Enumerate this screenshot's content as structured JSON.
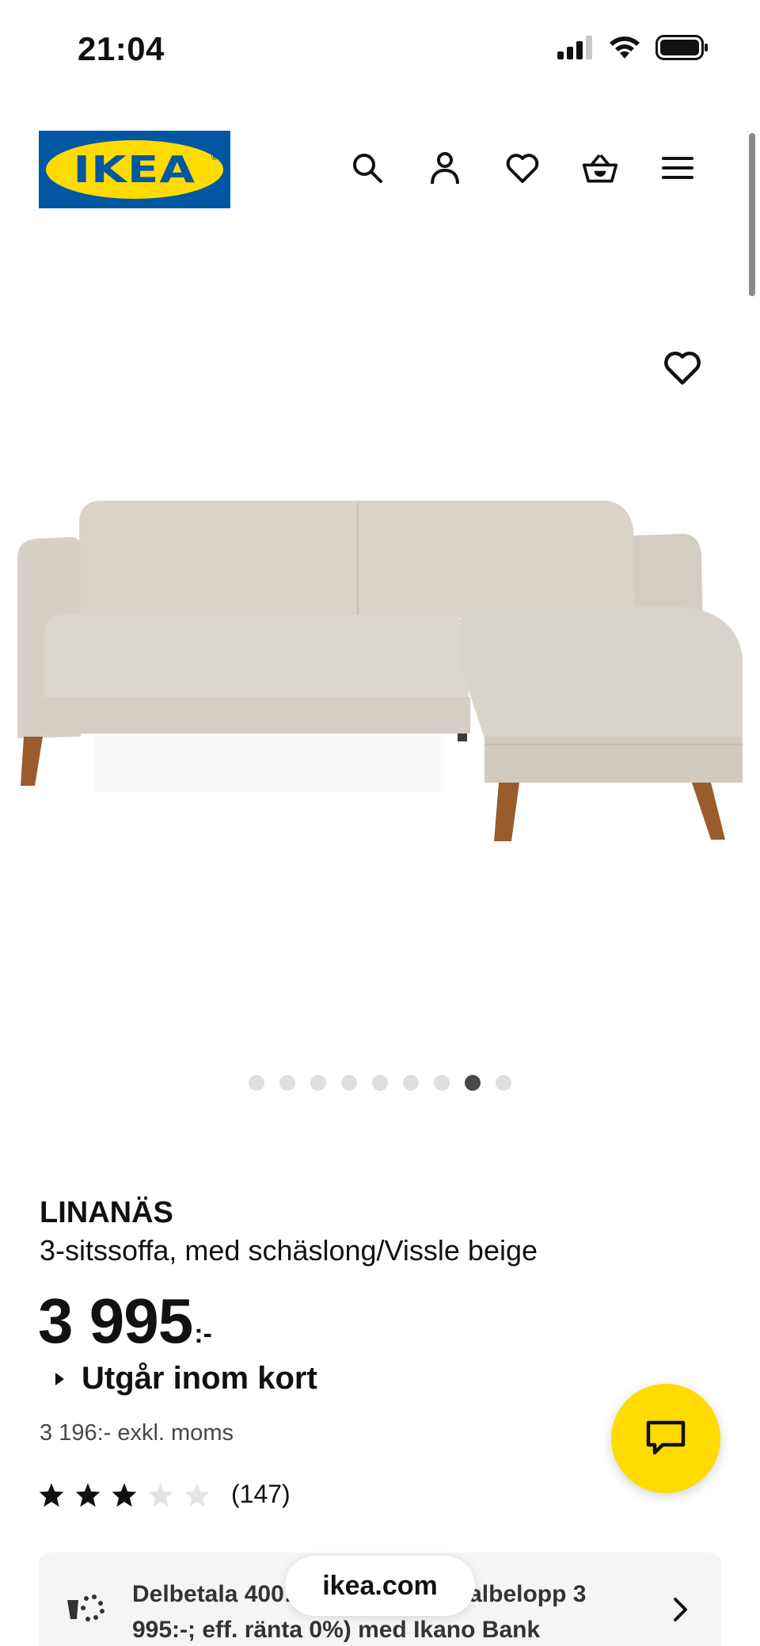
{
  "status_bar": {
    "time": "21:04"
  },
  "header": {
    "logo_text": "IKEA"
  },
  "product": {
    "name": "LINANÄS",
    "description": "3-sitssoffa, med schäslong/Vissle beige",
    "price": "3 995",
    "price_suffix": ":-",
    "availability": "Utgår inom kort",
    "price_excl_vat": "3 196:- exkl. moms",
    "rating": {
      "value": 3,
      "max": 5,
      "count": "(147)"
    },
    "image_count": 9,
    "active_image_index": 7
  },
  "financing": {
    "text": "Delbetala 400:- i månaden (totalbelopp 3 995:-; eff. ränta 0%) med Ikano Bank"
  },
  "browser": {
    "url": "ikea.com"
  },
  "colors": {
    "ikea_blue": "#0058a3",
    "ikea_yellow": "#ffdb00",
    "sofa_beige": "#d6d0c6",
    "wood": "#9a5b2e"
  }
}
